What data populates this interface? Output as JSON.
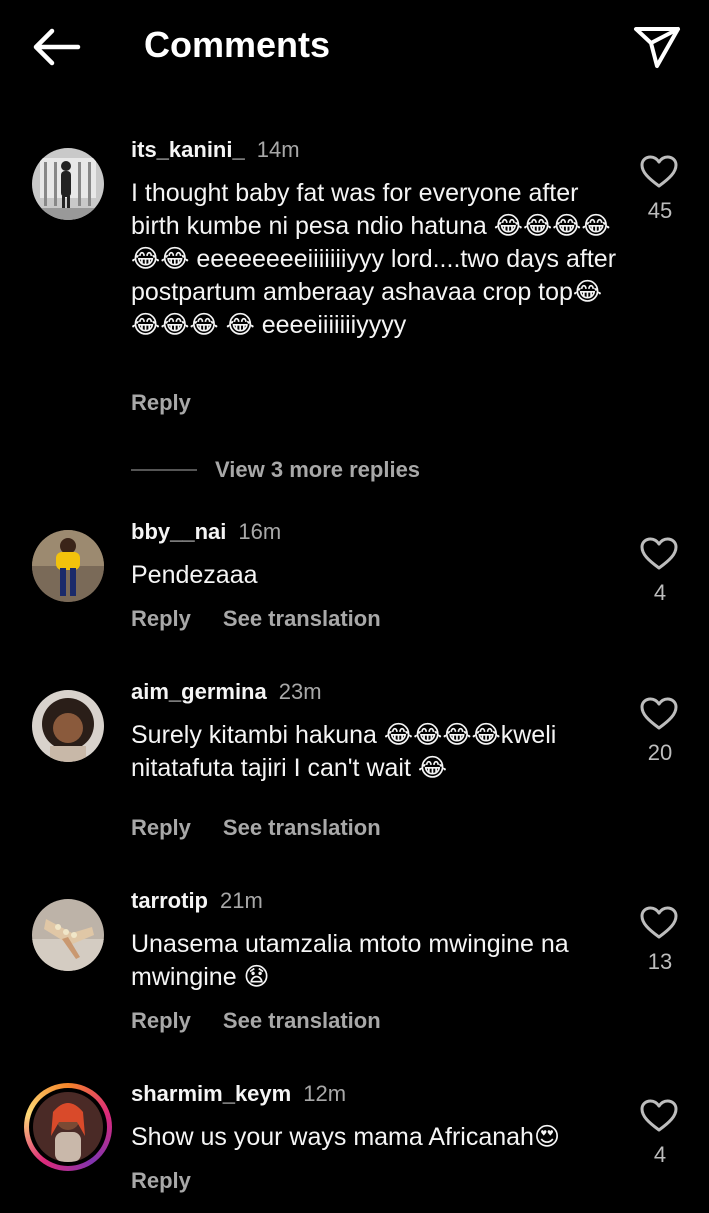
{
  "header": {
    "title": "Comments"
  },
  "comments": [
    {
      "username": "its_kanini_",
      "time": "14m",
      "text": "I thought baby fat was for everyone after birth kumbe ni pesa ndio hatuna 😂😂😂😂😂😂 eeeeeeeeiiiiiiiyyy lord....two days after postpartum amberaay ashavaa crop top😂😂😂😂 😂 eeeeiiiiiiiyyyy",
      "reply": "Reply",
      "likes": "45",
      "more_replies": "View 3 more replies"
    },
    {
      "username": "bby__nai",
      "time": "16m",
      "text": "Pendezaaa",
      "reply": "Reply",
      "translate": "See translation",
      "likes": "4"
    },
    {
      "username": "aim_germina",
      "time": "23m",
      "text": "Surely kitambi hakuna 😂😂😂😂kweli nitatafuta tajiri I can't wait 😂",
      "reply": "Reply",
      "translate": "See translation",
      "likes": "20"
    },
    {
      "username": "tarrotip",
      "time": "21m",
      "text": "Unasema utamzalia mtoto mwingine na mwingine 😧",
      "reply": "Reply",
      "translate": "See translation",
      "likes": "13"
    },
    {
      "username": "sharmim_keym",
      "time": "12m",
      "text": "Show us your ways mama Africanah😍",
      "reply": "Reply",
      "likes": "4"
    }
  ],
  "icons": {
    "back": "back-arrow-icon",
    "send": "send-icon",
    "like": "heart-outline-icon"
  }
}
